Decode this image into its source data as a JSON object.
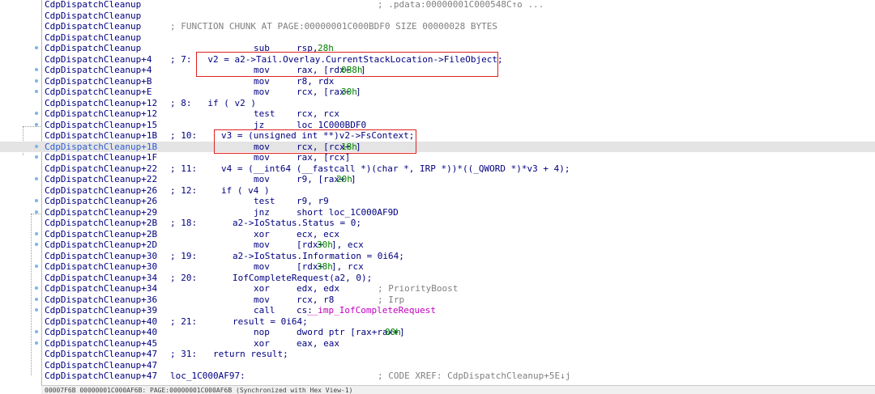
{
  "rows": [
    {
      "addr": "CdpDispatchCleanup",
      "segments": [
        {
          "text": "; .pdata:00000001C000548C↑o ...",
          "cls": "c-comment",
          "col": 466
        }
      ]
    },
    {
      "addr": "CdpDispatchCleanup",
      "segments": []
    },
    {
      "addr": "CdpDispatchCleanup",
      "segments": [
        {
          "text": "; FUNCTION CHUNK AT PAGE:00000001C000BDF0 SIZE 00000028 BYTES",
          "cls": "c-comment",
          "col": 210
        }
      ]
    },
    {
      "addr": "CdpDispatchCleanup",
      "segments": []
    },
    {
      "addr": "CdpDispatchCleanup",
      "dot": true,
      "segments": [
        {
          "text": "sub     rsp, ",
          "cls": "",
          "col": 313
        },
        {
          "text": "28h",
          "cls": "c-num",
          "col": 392
        }
      ]
    },
    {
      "addr": "CdpDispatchCleanup+4",
      "segments": [
        {
          "text": "; 7:   v2 = a2->Tail.Overlay.CurrentStackLocation->FileObject;",
          "cls": "c-pseudo",
          "col": 210
        }
      ]
    },
    {
      "addr": "CdpDispatchCleanup+4",
      "dot": true,
      "segments": [
        {
          "text": "mov     rax, [rdx+",
          "cls": "",
          "col": 313
        },
        {
          "text": "0B8h",
          "cls": "c-num",
          "col": 421
        },
        {
          "text": "]",
          "cls": "",
          "col": 445
        }
      ]
    },
    {
      "addr": "CdpDispatchCleanup+B",
      "dot": true,
      "segments": [
        {
          "text": "mov     r8, rdx",
          "cls": "",
          "col": 313
        }
      ]
    },
    {
      "addr": "CdpDispatchCleanup+E",
      "dot": true,
      "segments": [
        {
          "text": "mov     rcx, [rax+",
          "cls": "",
          "col": 313
        },
        {
          "text": "30h",
          "cls": "c-num",
          "col": 421
        },
        {
          "text": "]",
          "cls": "",
          "col": 439
        }
      ]
    },
    {
      "addr": "CdpDispatchCleanup+12",
      "segments": [
        {
          "text": "; 8:   if ( v2 )",
          "cls": "c-pseudo",
          "col": 210
        }
      ]
    },
    {
      "addr": "CdpDispatchCleanup+12",
      "dot": true,
      "segments": [
        {
          "text": "test    rcx, rcx",
          "cls": "",
          "col": 313
        }
      ]
    },
    {
      "addr": "CdpDispatchCleanup+15",
      "dot": true,
      "segments": [
        {
          "text": "jz      loc_1C000BDF0",
          "cls": "",
          "col": 313
        }
      ]
    },
    {
      "addr": "CdpDispatchCleanup+1B",
      "segments": [
        {
          "text": "; 10:",
          "cls": "c-pseudo",
          "col": 210
        },
        {
          "text": "v3 = (unsigned int **)v2->FsContext;",
          "cls": "c-pseudo",
          "col": 273
        }
      ]
    },
    {
      "addr": "CdpDispatchCleanup+1B",
      "dot": true,
      "selected": true,
      "segments": [
        {
          "text": "mov     rcx, [rcx+",
          "cls": "",
          "col": 313
        },
        {
          "text": "18h",
          "cls": "c-num",
          "col": 421
        },
        {
          "text": "]",
          "cls": "",
          "col": 439
        }
      ]
    },
    {
      "addr": "CdpDispatchCleanup+1F",
      "dot": true,
      "segments": [
        {
          "text": "mov     rax, [rcx]",
          "cls": "",
          "col": 313
        }
      ]
    },
    {
      "addr": "CdpDispatchCleanup+22",
      "segments": [
        {
          "text": "; 11:",
          "cls": "c-pseudo",
          "col": 210
        },
        {
          "text": "v4 = (__int64 (__fastcall *)(char *, IRP *))*((_QWORD *)*v3 + 4);",
          "cls": "c-pseudo",
          "col": 273
        }
      ]
    },
    {
      "addr": "CdpDispatchCleanup+22",
      "dot": true,
      "segments": [
        {
          "text": "mov     r9, [rax+",
          "cls": "",
          "col": 313
        },
        {
          "text": "20h",
          "cls": "c-num",
          "col": 415
        },
        {
          "text": "]",
          "cls": "",
          "col": 433
        }
      ]
    },
    {
      "addr": "CdpDispatchCleanup+26",
      "segments": [
        {
          "text": "; 12:",
          "cls": "c-pseudo",
          "col": 210
        },
        {
          "text": "if ( v4 )",
          "cls": "c-pseudo",
          "col": 273
        }
      ]
    },
    {
      "addr": "CdpDispatchCleanup+26",
      "dot": true,
      "segments": [
        {
          "text": "test    r9, r9",
          "cls": "",
          "col": 313
        }
      ]
    },
    {
      "addr": "CdpDispatchCleanup+29",
      "dot": true,
      "segments": [
        {
          "text": "jnz     short loc_1C000AF9D",
          "cls": "",
          "col": 313
        }
      ]
    },
    {
      "addr": "CdpDispatchCleanup+2B",
      "segments": [
        {
          "text": "; 18:",
          "cls": "c-pseudo",
          "col": 210
        },
        {
          "text": "a2->IoStatus.Status = 0;",
          "cls": "c-pseudo",
          "col": 287
        }
      ]
    },
    {
      "addr": "CdpDispatchCleanup+2B",
      "dot": true,
      "segments": [
        {
          "text": "xor     ecx, ecx",
          "cls": "",
          "col": 313
        }
      ]
    },
    {
      "addr": "CdpDispatchCleanup+2D",
      "dot": true,
      "segments": [
        {
          "text": "mov     [rdx+",
          "cls": "",
          "col": 313
        },
        {
          "text": "30h",
          "cls": "c-num",
          "col": 391
        },
        {
          "text": "], ecx",
          "cls": "",
          "col": 409
        }
      ]
    },
    {
      "addr": "CdpDispatchCleanup+30",
      "segments": [
        {
          "text": "; 19:",
          "cls": "c-pseudo",
          "col": 210
        },
        {
          "text": "a2->IoStatus.Information = 0i64;",
          "cls": "c-pseudo",
          "col": 287
        }
      ]
    },
    {
      "addr": "CdpDispatchCleanup+30",
      "dot": true,
      "segments": [
        {
          "text": "mov     [rdx+",
          "cls": "",
          "col": 313
        },
        {
          "text": "38h",
          "cls": "c-num",
          "col": 391
        },
        {
          "text": "], rcx",
          "cls": "",
          "col": 409
        }
      ]
    },
    {
      "addr": "CdpDispatchCleanup+34",
      "segments": [
        {
          "text": "; 20:",
          "cls": "c-pseudo",
          "col": 210
        },
        {
          "text": "IofCompleteRequest(a2, 0);",
          "cls": "c-pseudo",
          "col": 287
        }
      ]
    },
    {
      "addr": "CdpDispatchCleanup+34",
      "dot": true,
      "segments": [
        {
          "text": "xor     edx, edx",
          "cls": "",
          "col": 313
        },
        {
          "text": "; PriorityBoost",
          "cls": "c-comment",
          "col": 466
        }
      ]
    },
    {
      "addr": "CdpDispatchCleanup+36",
      "dot": true,
      "segments": [
        {
          "text": "mov     rcx, r8",
          "cls": "",
          "col": 313
        },
        {
          "text": "; Irp",
          "cls": "c-comment",
          "col": 466
        }
      ]
    },
    {
      "addr": "CdpDispatchCleanup+39",
      "dot": true,
      "segments": [
        {
          "text": "call    cs:",
          "cls": "",
          "col": 313
        },
        {
          "text": "__imp_IofCompleteRequest",
          "cls": "c-import",
          "col": 379
        }
      ]
    },
    {
      "addr": "CdpDispatchCleanup+40",
      "segments": [
        {
          "text": "; 21:",
          "cls": "c-pseudo",
          "col": 210
        },
        {
          "text": "result = 0i64;",
          "cls": "c-pseudo",
          "col": 287
        }
      ]
    },
    {
      "addr": "CdpDispatchCleanup+40",
      "dot": true,
      "segments": [
        {
          "text": "nop     dword ptr [rax+rax+",
          "cls": "",
          "col": 313
        },
        {
          "text": "00h",
          "cls": "c-num",
          "col": 475
        },
        {
          "text": "]",
          "cls": "",
          "col": 493
        }
      ]
    },
    {
      "addr": "CdpDispatchCleanup+45",
      "dot": true,
      "segments": [
        {
          "text": "xor     eax, eax",
          "cls": "",
          "col": 313
        }
      ]
    },
    {
      "addr": "CdpDispatchCleanup+47",
      "segments": [
        {
          "text": "; 31:   return result;",
          "cls": "c-pseudo",
          "col": 210
        }
      ]
    },
    {
      "addr": "CdpDispatchCleanup+47",
      "segments": []
    },
    {
      "addr": "CdpDispatchCleanup+47",
      "segments": [
        {
          "text": "loc_1C000AF97:",
          "cls": "",
          "col": 210
        },
        {
          "text": "; CODE XREF: CdpDispatchCleanup+5E↓j",
          "cls": "c-comment",
          "col": 466
        }
      ]
    }
  ],
  "status_bar": {
    "text": "00007F6B 00000001C000AF6B: PAGE:00000001C000AF6B (Synchronized with Hex View-1)"
  },
  "colors": {
    "highlight_box": "#e02020",
    "selected_row": "#e4e4e4",
    "numbers": "#008000",
    "comments": "#808080",
    "imports": "#c000c0"
  }
}
